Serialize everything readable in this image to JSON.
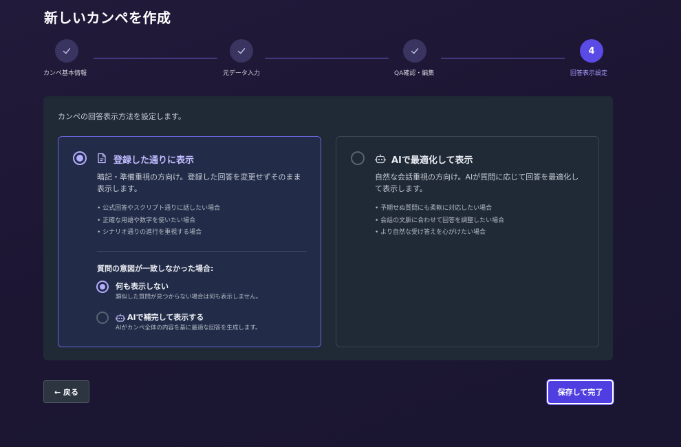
{
  "page_title": "新しいカンペを作成",
  "stepper": {
    "steps": [
      {
        "label": "カンペ基本情報",
        "status": "done"
      },
      {
        "label": "元データ入力",
        "status": "done"
      },
      {
        "label": "QA確認・編集",
        "status": "done"
      },
      {
        "label": "回答表示設定",
        "number": "4",
        "status": "active"
      }
    ]
  },
  "panel": {
    "description": "カンペの回答表示方法を設定します。",
    "options": [
      {
        "title": "登録した通りに表示",
        "icon": "document-icon",
        "selected": true,
        "description": "暗記・準備重視の方向け。登録した回答を変更せずそのまま表示します。",
        "bullets": [
          "公式回答やスクリプト通りに話したい場合",
          "正確な用語や数字を使いたい場合",
          "シナリオ通りの進行を重視する場合"
        ],
        "fallback": {
          "heading": "質問の意図が一致しなかった場合:",
          "choices": [
            {
              "title": "何も表示しない",
              "description": "類似した質問が見つからない場合は何も表示しません。",
              "selected": true
            },
            {
              "title": "AIで補完して表示する",
              "icon": "robot-icon",
              "description": "AIがカンペ全体の内容を基に最適な回答を生成します。",
              "selected": false
            }
          ]
        }
      },
      {
        "title": "AIで最適化して表示",
        "icon": "robot-icon",
        "selected": false,
        "description": "自然な会話重視の方向け。AIが質問に応じて回答を最適化して表示します。",
        "bullets": [
          "予期せぬ質問にも柔軟に対応したい場合",
          "会話の文脈に合わせて回答を調整したい場合",
          "より自然な受け答えを心がけたい場合"
        ]
      }
    ]
  },
  "buttons": {
    "back": "← 戻る",
    "save": "保存して完了"
  },
  "colors": {
    "accent": "#5a4be6",
    "selected_border": "#6a64d8",
    "radio_on": "#b5adff"
  }
}
